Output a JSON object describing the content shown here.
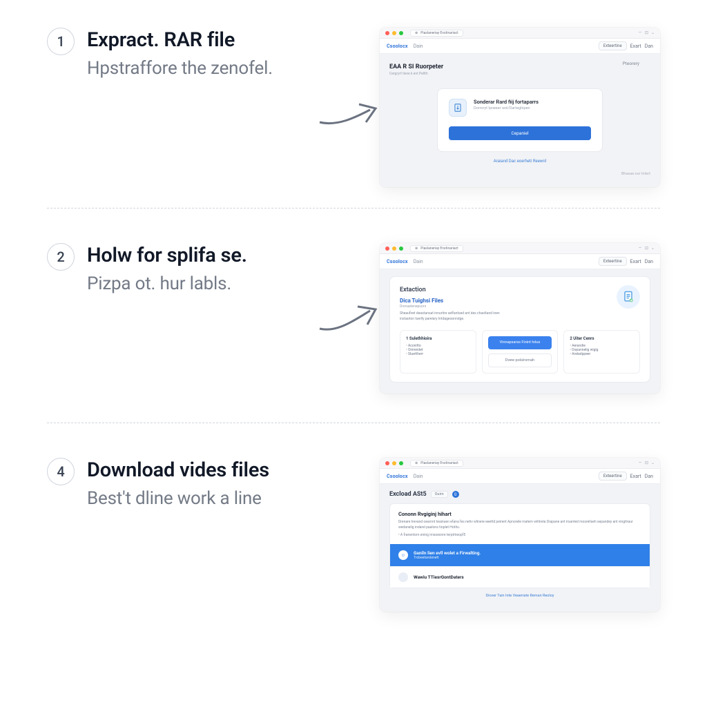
{
  "steps": [
    {
      "num": "1",
      "title": "Expract. RAR file",
      "subtitle": "Hpstraffore the zenofel."
    },
    {
      "num": "2",
      "title": "Holw for splifa se.",
      "subtitle": "Pizpa ot. hur labls."
    },
    {
      "num": "4",
      "title": "Download vides files",
      "subtitle": "Best't dline work a line"
    }
  ],
  "browser": {
    "tab_label": "Piaslaneriay Enstinariact",
    "brand": "Csoolocx",
    "nav_item": "Dain",
    "pill_label": "Exteertine",
    "right_a": "Exart",
    "right_b": "Dan"
  },
  "step1": {
    "heading": "EAA R SI Ruorpeter",
    "subheading": "Cergryrt tieve k ent Pellth",
    "right_label": "Pteorery",
    "card_title": "Sonderar Rard fiij fortaparrs",
    "card_sub": "Dorroryt Ipneeer wol/Darteghipen",
    "cta": "Cepaniel",
    "below_link": "Araiand Dac eoerheti Reewnl",
    "footer": "Bhasae our Intert"
  },
  "step2": {
    "heading": "Extaction",
    "h2": "Dica Tuighsi Files",
    "sub": "Drenaatenepuors",
    "text1": "Sheaufiret deaotansat innuritre selfantsed ant des chaoltand inen",
    "text2": "instaoton Iuerlly parelary Intdageoonndge.",
    "box1_h": "1 Sulethhioira",
    "box1_a": "Aconitto",
    "box1_b": "Onirendet",
    "box1_c": "Stuettherr",
    "box2_chip": "Vinnapsarss Finint hdus",
    "box2_ghost": "Dvew polsiromah",
    "box3_h": "2 Uiter Cenrs",
    "box3_a": "Aerandie",
    "box3_b": "Dopannelig wigig",
    "box3_c": "Areladppeer"
  },
  "step4": {
    "title": "Excload ASt5",
    "badge": "Ouirn",
    "dot": "0",
    "card_h": "Cononn Rvgiginj hihart",
    "card_p": "Drenare trevand oeamnt teainuen efana fes netiv wlinere eeettd peirent Apnorele matern wiitirela Drapane ant irsanted mosreliseh sepandey ant vingitraur wedanelig indarel paalons tioplet Hotitu.",
    "card_li": "• A franentorn ening imsoesnre terptriieopf5",
    "banner_title": "Ganiln lien evll wolet a Firwalting.",
    "banner_sub": "Trobeetandenett",
    "row2_title": "Wawiu TTiesrGontDaters",
    "footer": "Diover Tain Inte Veaerrate Reman Reoloy"
  }
}
